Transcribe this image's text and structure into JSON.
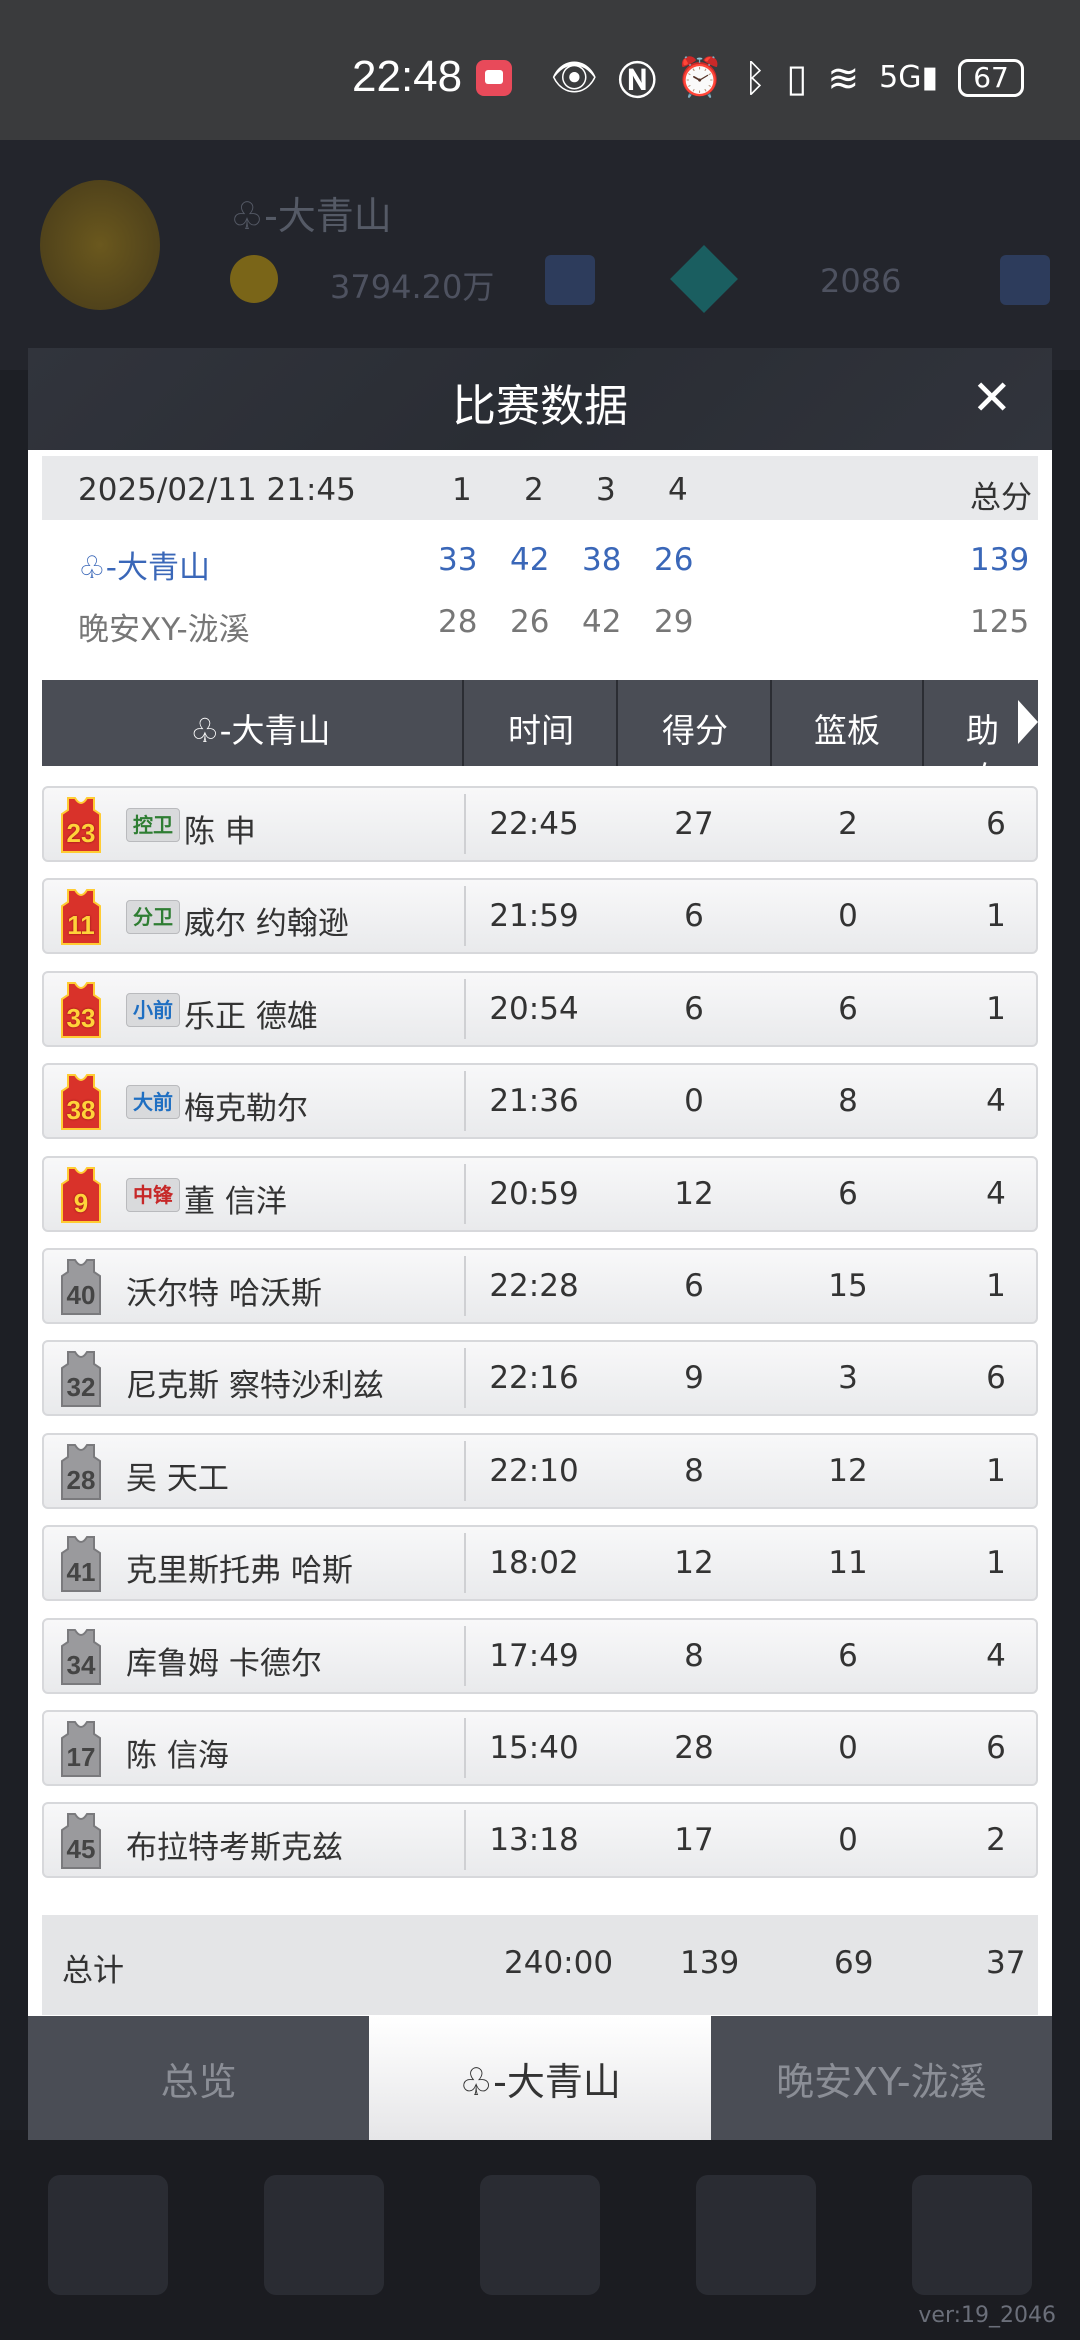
{
  "status_bar": {
    "time": "22:48",
    "icons": [
      "notification-icon",
      "eye-icon",
      "nfc-icon",
      "alarm-icon",
      "bluetooth-icon",
      "vibrate-icon",
      "wifi-icon",
      "signal-5g-icon"
    ],
    "battery": "67"
  },
  "background": {
    "team_title": "♧-大青山",
    "coins": "3794.20万",
    "gems": "2086",
    "version": "ver:19_2046"
  },
  "modal": {
    "title": "比赛数据",
    "close_symbol": "✕",
    "score": {
      "date": "2025/02/11 21:45",
      "quarters": [
        "1",
        "2",
        "3",
        "4"
      ],
      "total_label": "总分",
      "home": {
        "name": "♧-大青山",
        "q": [
          "33",
          "42",
          "38",
          "26"
        ],
        "total": "139"
      },
      "away": {
        "name": "晚安XY-泷溪",
        "q": [
          "28",
          "26",
          "42",
          "29"
        ],
        "total": "125"
      }
    },
    "table_header": {
      "team": "♧-大青山",
      "time": "时间",
      "points": "得分",
      "rebounds": "篮板",
      "assists": "助攻"
    },
    "players": [
      {
        "num": "23",
        "pos": "控卫",
        "pos_color": "#2e7d32",
        "name": "陈 申",
        "time": "22:45",
        "pts": "27",
        "reb": "2",
        "ast": "6",
        "starter": true
      },
      {
        "num": "11",
        "pos": "分卫",
        "pos_color": "#2e7d32",
        "name": "威尔  约翰逊",
        "time": "21:59",
        "pts": "6",
        "reb": "0",
        "ast": "1",
        "starter": true
      },
      {
        "num": "33",
        "pos": "小前",
        "pos_color": "#1f6fc2",
        "name": "乐正 德雄",
        "time": "20:54",
        "pts": "6",
        "reb": "6",
        "ast": "1",
        "starter": true
      },
      {
        "num": "38",
        "pos": "大前",
        "pos_color": "#1f6fc2",
        "name": "梅克勒尔",
        "time": "21:36",
        "pts": "0",
        "reb": "8",
        "ast": "4",
        "starter": true
      },
      {
        "num": "9",
        "pos": "中锋",
        "pos_color": "#c62828",
        "name": "董 信洋",
        "time": "20:59",
        "pts": "12",
        "reb": "6",
        "ast": "4",
        "starter": true
      },
      {
        "num": "40",
        "pos": "",
        "pos_color": "",
        "name": "沃尔特 哈沃斯",
        "time": "22:28",
        "pts": "6",
        "reb": "15",
        "ast": "1",
        "starter": false
      },
      {
        "num": "32",
        "pos": "",
        "pos_color": "",
        "name": "尼克斯 察特沙利兹",
        "time": "22:16",
        "pts": "9",
        "reb": "3",
        "ast": "6",
        "starter": false
      },
      {
        "num": "28",
        "pos": "",
        "pos_color": "",
        "name": "吴 天工",
        "time": "22:10",
        "pts": "8",
        "reb": "12",
        "ast": "1",
        "starter": false
      },
      {
        "num": "41",
        "pos": "",
        "pos_color": "",
        "name": "克里斯托弗 哈斯",
        "time": "18:02",
        "pts": "12",
        "reb": "11",
        "ast": "1",
        "starter": false
      },
      {
        "num": "34",
        "pos": "",
        "pos_color": "",
        "name": "库鲁姆 卡德尔",
        "time": "17:49",
        "pts": "8",
        "reb": "6",
        "ast": "4",
        "starter": false
      },
      {
        "num": "17",
        "pos": "",
        "pos_color": "",
        "name": "陈 信海",
        "time": "15:40",
        "pts": "28",
        "reb": "0",
        "ast": "6",
        "starter": false
      },
      {
        "num": "45",
        "pos": "",
        "pos_color": "",
        "name": "布拉特考斯克兹",
        "time": "13:18",
        "pts": "17",
        "reb": "0",
        "ast": "2",
        "starter": false
      }
    ],
    "totals": {
      "label": "总计",
      "time": "240:00",
      "pts": "139",
      "reb": "69",
      "ast": "37"
    },
    "tabs": [
      "总览",
      "♧-大青山",
      "晚安XY-泷溪"
    ]
  }
}
